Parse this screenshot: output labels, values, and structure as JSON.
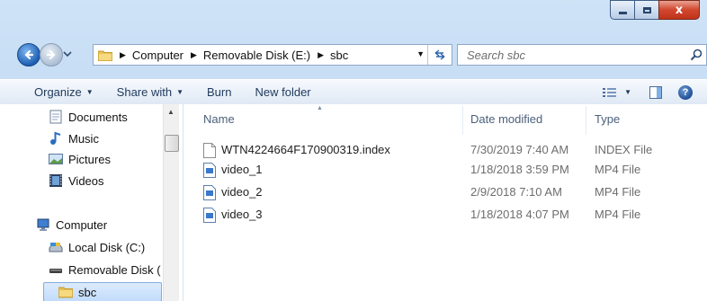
{
  "window": {
    "controls": {
      "close_glyph": "x"
    }
  },
  "address": {
    "crumbs": [
      "Computer",
      "Removable Disk (E:)",
      "sbc"
    ]
  },
  "search": {
    "placeholder": "Search sbc"
  },
  "toolbar": {
    "organize": "Organize",
    "share_with": "Share with",
    "burn": "Burn",
    "new_folder": "New folder"
  },
  "nav_tree": {
    "documents": "Documents",
    "music": "Music",
    "pictures": "Pictures",
    "videos": "Videos",
    "computer": "Computer",
    "local_disk": "Local Disk (C:)",
    "removable_disk": "Removable Disk (",
    "sbc": "sbc"
  },
  "columns": {
    "name": "Name",
    "date_modified": "Date modified",
    "type": "Type"
  },
  "files": [
    {
      "name": "WTN4224664F170900319.index",
      "date": "7/30/2019 7:40 AM",
      "type": "INDEX File",
      "icon": "blank-file-icon"
    },
    {
      "name": "video_1",
      "date": "1/18/2018 3:59 PM",
      "type": "MP4 File",
      "icon": "video-file-icon"
    },
    {
      "name": "video_2",
      "date": "2/9/2018 7:10 AM",
      "type": "MP4 File",
      "icon": "video-file-icon"
    },
    {
      "name": "video_3",
      "date": "1/18/2018 4:07 PM",
      "type": "MP4 File",
      "icon": "video-file-icon"
    }
  ],
  "colors": {
    "accent": "#1e395b",
    "selection": "#c2dcfc",
    "muted_text": "#6d6d6d"
  }
}
